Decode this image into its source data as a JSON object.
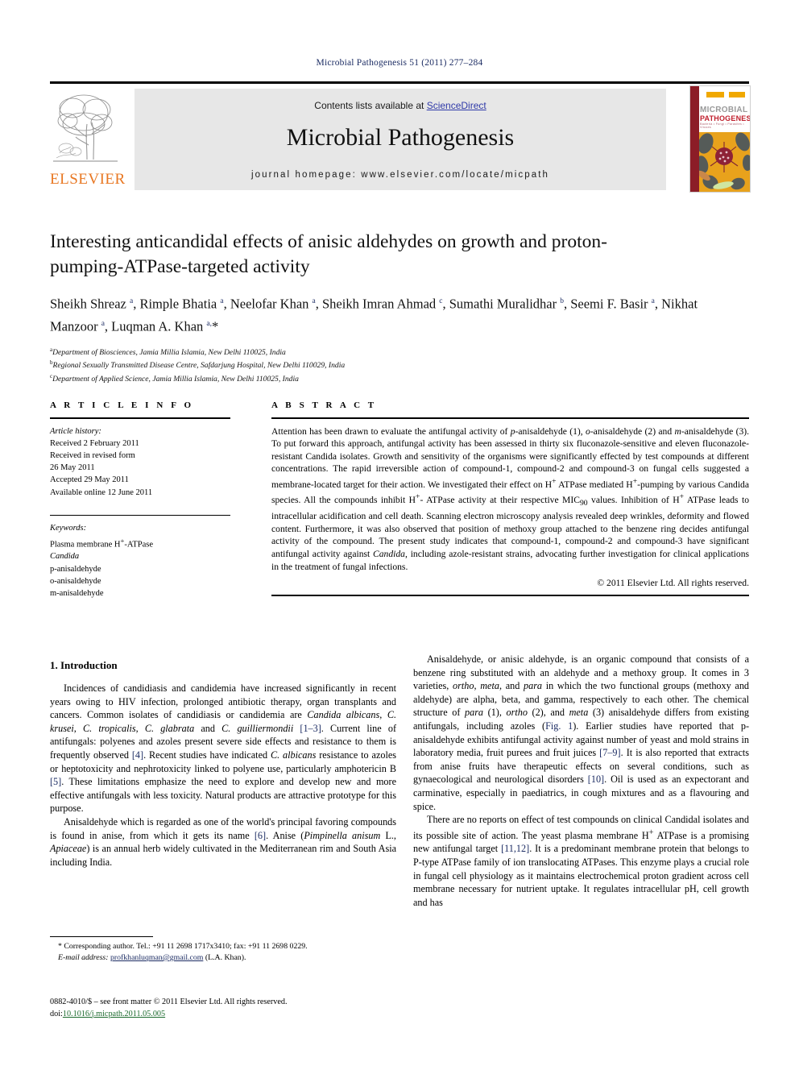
{
  "running_head": "Microbial Pathogenesis 51 (2011) 277–284",
  "masthead": {
    "contents_prefix": "Contents lists available at ",
    "sciencedirect": "ScienceDirect",
    "journal_title": "Microbial Pathogenesis",
    "homepage": "journal homepage: www.elsevier.com/locate/micpath",
    "publisher_wordmark": "ELSEVIER",
    "cover": {
      "line1": "MICROBIAL",
      "line2": "PATHOGENESIS",
      "line3": "Bacteria • Fungi • Parasites • Viruses"
    },
    "colors": {
      "elsevier_orange": "#E87722",
      "link_blue": "#2f39a8",
      "band_gray": "#e7e7e7",
      "cover_red": "#8c1d27",
      "cover_gold": "#e8a21c"
    }
  },
  "article": {
    "title": "Interesting anticandidal effects of anisic aldehydes on growth and proton-pumping-ATPase-targeted activity",
    "authors_html": "Sheikh Shreaz <sup>a</sup>, Rimple Bhatia <sup>a</sup>, Neelofar Khan <sup>a</sup>, Sheikh Imran Ahmad <sup>c</sup>, Sumathi Muralidhar <sup>b</sup>, Seemi F. Basir <sup>a</sup>, Nikhat Manzoor <sup>a</sup>, Luqman A. Khan <sup>a,</sup>*",
    "affiliations": [
      {
        "marker": "a",
        "text": "Department of Biosciences, Jamia Millia Islamia, New Delhi 110025, India"
      },
      {
        "marker": "b",
        "text": "Regional Sexually Transmitted Disease Centre, Safdarjung Hospital, New Delhi 110029, India"
      },
      {
        "marker": "c",
        "text": "Department of Applied Science, Jamia Millia Islamia, New Delhi 110025, India"
      }
    ]
  },
  "article_info": {
    "heading": "A R T I C L E  I N F O",
    "history_label": "Article history:",
    "history": [
      "Received 2 February 2011",
      "Received in revised form",
      "26 May 2011",
      "Accepted 29 May 2011",
      "Available online 12 June 2011"
    ],
    "keywords_label": "Keywords:",
    "keywords": [
      "Plasma membrane H+-ATPase",
      "Candida",
      "p-anisaldehyde",
      "o-anisaldehyde",
      "m-anisaldehyde"
    ]
  },
  "abstract": {
    "heading": "A B S T R A C T",
    "text_html": "Attention has been drawn to evaluate the antifungal activity of <span class=\"it\">p</span>-anisaldehyde (1), <span class=\"it\">o</span>-anisaldehyde (2) and <span class=\"it\">m</span>-anisaldehyde (3). To put forward this approach, antifungal activity has been assessed in thirty six fluconazole-sensitive and eleven fluconazole-resistant Candida isolates. Growth and sensitivity of the organisms were significantly effected by test compounds at different concentrations. The rapid irreversible action of compound-1, compound-2 and compound-3 on fungal cells suggested a membrane-located target for their action. We investigated their effect on H<sup>+</sup> ATPase mediated H<sup>+</sup>-pumping by various Candida species. All the compounds inhibit H<sup>+</sup>- ATPase activity at their respective MIC<sub>90</sub> values. Inhibition of H<sup>+</sup> ATPase leads to intracellular acidification and cell death. Scanning electron microscopy analysis revealed deep wrinkles, deformity and flowed content. Furthermore, it was also observed that position of methoxy group attached to the benzene ring decides antifungal activity of the compound. The present study indicates that compound-1, compound-2 and compound-3 have significant antifungal activity against <span class=\"it\">Candida</span>, including azole-resistant strains, advocating further investigation for clinical applications in the treatment of fungal infections.",
    "copyright": "© 2011 Elsevier Ltd. All rights reserved."
  },
  "body": {
    "section_number_title": "1. Introduction",
    "left_paragraphs_html": [
      "Incidences of candidiasis and candidemia have increased significantly in recent years owing to HIV infection, prolonged antibiotic therapy, organ transplants and cancers. Common isolates of candidiasis or candidemia are <span class=\"it\">Candida albicans</span>, <span class=\"it\">C. krusei</span>, <span class=\"it\">C. tropicalis</span>, <span class=\"it\">C. glabrata</span> and <span class=\"it\">C. guilliermondii</span> <span class=\"ref\">[1&ndash;3]</span>. Current line of antifungals: polyenes and azoles present severe side effects and resistance to them is frequently observed <span class=\"ref\">[4]</span>. Recent studies have indicated <span class=\"it\">C. albicans</span> resistance to azoles or heptotoxicity and nephrotoxicity linked to polyene use, particularly amphotericin B <span class=\"ref\">[5]</span>. These limitations emphasize the need to explore and develop new and more effective antifungals with less toxicity. Natural products are attractive prototype for this purpose.",
      "Anisaldehyde which is regarded as one of the world's principal favoring compounds is found in anise, from which it gets its name <span class=\"ref\">[6]</span>. Anise (<span class=\"it\">Pimpinella anisum</span> L., <span class=\"it\">Apiaceae</span>) is an annual herb widely cultivated in the Mediterranean rim and South Asia including India."
    ],
    "right_paragraphs_html": [
      "Anisaldehyde, or anisic aldehyde, is an organic compound that consists of a benzene ring substituted with an aldehyde and a methoxy group. It comes in 3 varieties, <span class=\"it\">ortho</span>, <span class=\"it\">meta</span>, and <span class=\"it\">para</span> in which the two functional groups (methoxy and aldehyde) are alpha, beta, and gamma, respectively to each other. The chemical structure of <span class=\"it\">para</span> (1), <span class=\"it\">ortho</span> (2), and <span class=\"it\">meta</span> (3) anisaldehyde differs from existing antifungals, including azoles (<span class=\"ref\">Fig. 1</span>). Earlier studies have reported that p-anisaldehyde exhibits antifungal activity against number of yeast and mold strains in laboratory media, fruit purees and fruit juices <span class=\"ref\">[7&ndash;9]</span>. It is also reported that extracts from anise fruits have therapeutic effects on several conditions, such as gynaecological and neurological disorders <span class=\"ref\">[10]</span>. Oil is used as an expectorant and carminative, especially in paediatrics, in cough mixtures and as a flavouring and spice.",
      "There are no reports on effect of test compounds on clinical Candidal isolates and its possible site of action. The yeast plasma membrane H<sup>+</sup> ATPase is a promising new antifungal target <span class=\"ref\">[11,12]</span>. It is a predominant membrane protein that belongs to P-type ATPase family of ion translocating ATPases. This enzyme plays a crucial role in fungal cell physiology as it maintains electrochemical proton gradient across cell membrane necessary for nutrient uptake. It regulates intracellular pH, cell growth and has"
    ]
  },
  "footnotes": {
    "corresponding_html": "* Corresponding author. Tel.: +91 11 2698 1717x3410; fax: +91 11 2698 0229.",
    "email_label": "E-mail address:",
    "email": "profkhanluqman@gmail.com",
    "email_suffix": "(L.A. Khan).",
    "imprint_line": "0882-4010/$ – see front matter © 2011 Elsevier Ltd. All rights reserved.",
    "doi_label": "doi:",
    "doi": "10.1016/j.micpath.2011.05.005"
  }
}
